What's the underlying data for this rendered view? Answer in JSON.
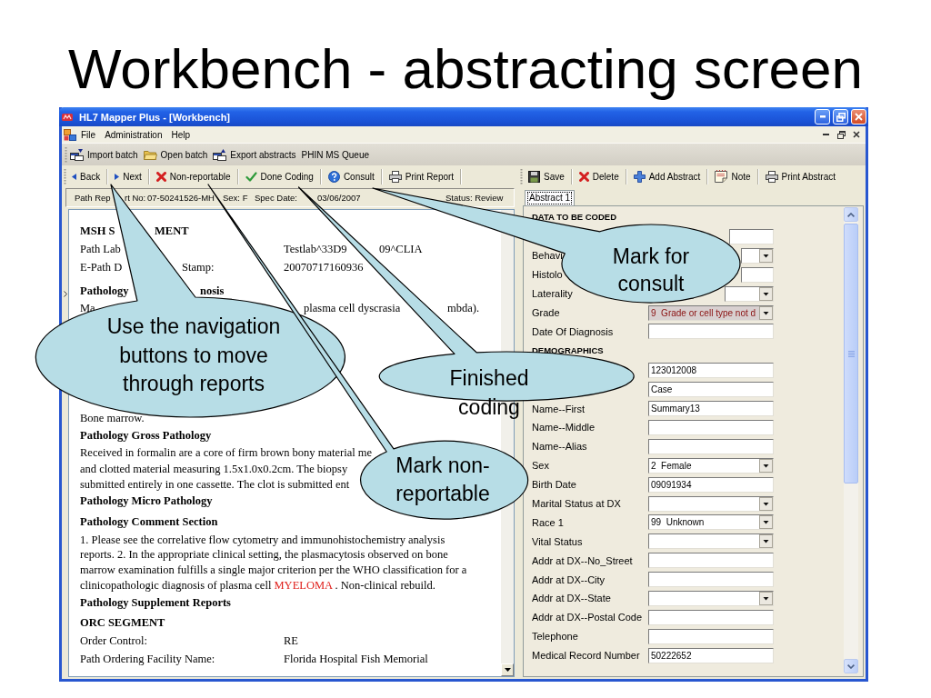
{
  "slide_title": "Workbench - abstracting screen",
  "window": {
    "title": "HL7 Mapper Plus - [Workbench]"
  },
  "menu": [
    "File",
    "Administration",
    "Help"
  ],
  "toolbar": [
    "Import batch",
    "Open batch",
    "Export abstracts",
    "PHIN MS Queue"
  ],
  "report_toolbar": [
    "Back",
    "Next",
    "Non-reportable",
    "Done Coding",
    "Consult",
    "Print Report"
  ],
  "abstract_toolbar": [
    "Save",
    "Delete",
    "Add Abstract",
    "Note",
    "Print Abstract"
  ],
  "report_header": [
    "Path Rep",
    "rt No:",
    "07-50241526-MH",
    "Sex: F",
    "Spec Date:",
    "03/06/2007",
    "Status: Review"
  ],
  "report": [
    {
      "kind": "heading",
      "parts": [
        "MSH S",
        "MENT"
      ]
    },
    {
      "kind": "row",
      "parts": [
        "Path Lab",
        "Testlab^33D9",
        "09^CLIA"
      ]
    },
    {
      "kind": "row",
      "parts": [
        "E-Path D",
        "Stamp:",
        "20070717160936"
      ]
    },
    {
      "kind": "heading",
      "parts": [
        "Pathology",
        "nosis"
      ]
    },
    {
      "kind": "row",
      "parts": [
        "Ma",
        "plasma cell dyscrasia",
        "mbda)."
      ]
    },
    {
      "kind": "row",
      "parts": [
        "Bone marrow."
      ]
    },
    {
      "kind": "heading",
      "parts": [
        "Pathology Gross Pathology"
      ]
    },
    {
      "kind": "row",
      "parts": [
        "Received in formalin are a core of firm brown bony material me"
      ]
    },
    {
      "kind": "row",
      "parts": [
        "and clotted material measuring 1.5x1.0x0.2cm. The biopsy"
      ]
    },
    {
      "kind": "row",
      "parts": [
        "submitted entirely in one cassette. The clot is submitted ent"
      ]
    },
    {
      "kind": "heading",
      "parts": [
        "Pathology Micro Pathology"
      ]
    },
    {
      "kind": "heading",
      "parts": [
        "Pathology Comment Section"
      ]
    },
    {
      "kind": "paragraph",
      "segments": [
        {
          "text": "1. Please see the correlative flow cytometry and immunohistochemistry analysis reports. 2. In the appropriate clinical setting, the plasmacytosis observed on bone marrow examination fulfills a single major criterion per the WHO classification for a clinicopathologic diagnosis of plasma cell ",
          "highlight": false
        },
        {
          "text": "MYELOMA",
          "highlight": true
        },
        {
          "text": " . Non-clinical rebuild.",
          "highlight": false
        }
      ]
    },
    {
      "kind": "heading",
      "parts": [
        "Pathology Supplement Reports"
      ]
    },
    {
      "kind": "heading",
      "parts": [
        "ORC SEGMENT"
      ]
    },
    {
      "kind": "row",
      "parts": [
        "Order Control:",
        "RE"
      ]
    },
    {
      "kind": "row",
      "parts": [
        "Path Ordering Facility Name:",
        "Florida Hospital Fish Memorial"
      ]
    }
  ],
  "abstract_panel": {
    "tab": {
      "label": "Abstract 1",
      "selected": true
    },
    "fields": [
      {
        "kind": "section",
        "label": "DATA TO BE CODED"
      },
      {
        "kind": "text",
        "flagged": false
      },
      {
        "kind": "combo",
        "label": "Behavi",
        "flagged": false
      },
      {
        "kind": "text",
        "label": "Histolo",
        "flagged": false
      },
      {
        "kind": "combo",
        "label": "Laterality",
        "flagged": false
      },
      {
        "kind": "combo",
        "label": "Grade",
        "value": "9  Grade or cell type not d",
        "flagged": true
      },
      {
        "kind": "text",
        "label": "Date Of Diagnosis",
        "flagged": false
      },
      {
        "kind": "section",
        "label": "DEMOGRAPHICS"
      },
      {
        "kind": "text",
        "value": "123012008",
        "flagged": false
      },
      {
        "kind": "text",
        "value": "Case",
        "flagged": false
      },
      {
        "kind": "text",
        "label": "Name--First",
        "value": "Summary13",
        "flagged": false
      },
      {
        "kind": "text",
        "label": "Name--Middle",
        "flagged": false
      },
      {
        "kind": "text",
        "label": "Name--Alias",
        "flagged": false
      },
      {
        "kind": "combo",
        "label": "Sex",
        "value": "2  Female",
        "flagged": false
      },
      {
        "kind": "text",
        "label": "Birth Date",
        "value": "09091934",
        "flagged": false
      },
      {
        "kind": "combo",
        "label": "Marital Status at DX",
        "flagged": false
      },
      {
        "kind": "combo",
        "label": "Race 1",
        "value": "99  Unknown",
        "flagged": false
      },
      {
        "kind": "combo",
        "label": "Vital Status",
        "flagged": false
      },
      {
        "kind": "text",
        "label": "Addr at DX--No_Street",
        "flagged": false
      },
      {
        "kind": "text",
        "label": "Addr at DX--City",
        "flagged": false
      },
      {
        "kind": "combo",
        "label": "Addr at DX--State",
        "flagged": false
      },
      {
        "kind": "text",
        "label": "Addr at DX--Postal Code",
        "flagged": false
      },
      {
        "kind": "text",
        "label": "Telephone",
        "flagged": false
      },
      {
        "kind": "text",
        "label": "Medical Record Number",
        "value": "50222652",
        "flagged": false
      }
    ]
  },
  "callouts": [
    {
      "text": "Use the navigation buttons to move through reports"
    },
    {
      "text": "Mark non-reportable"
    },
    {
      "text": "Finished coding"
    },
    {
      "text": "Mark for consult"
    }
  ]
}
